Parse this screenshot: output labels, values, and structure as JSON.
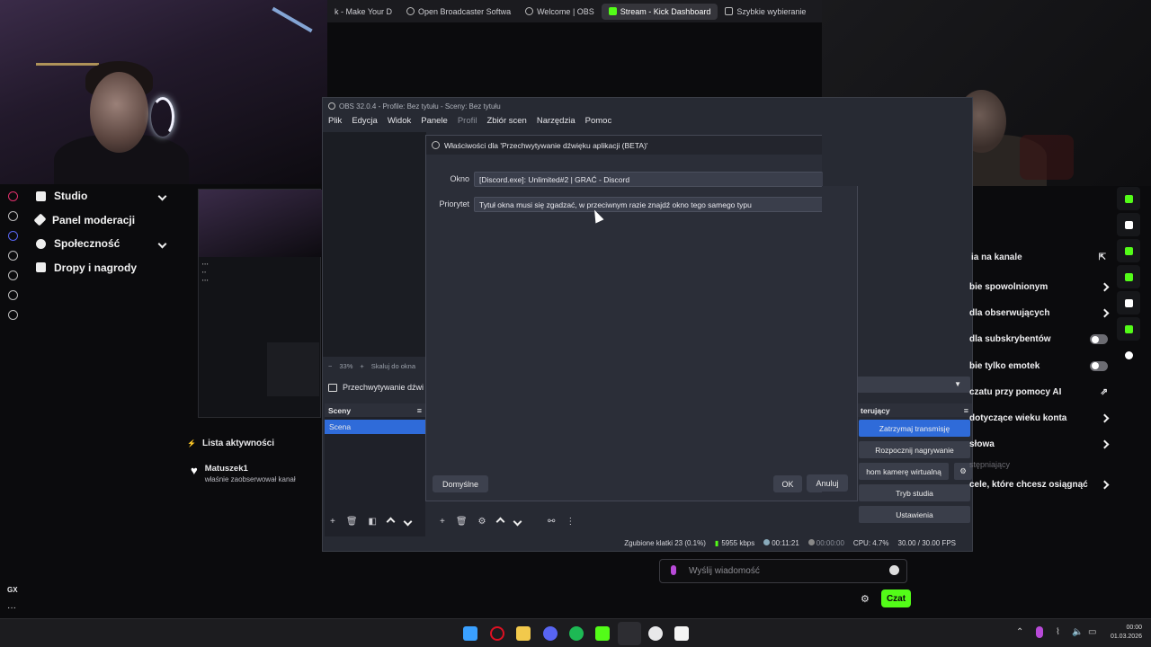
{
  "browser_tabs": [
    {
      "label": "k - Make Your D",
      "active": false
    },
    {
      "label": "Open Broadcaster Softwa",
      "active": false
    },
    {
      "label": "Welcome | OBS",
      "active": false
    },
    {
      "label": "Stream - Kick Dashboard",
      "active": true
    },
    {
      "label": "Szybkie wybieranie",
      "active": false
    }
  ],
  "obs": {
    "title": "OBS 32.0.4 - Profile: Bez tytułu - Sceny: Bez tytułu",
    "menu": [
      "Plik",
      "Edycja",
      "Widok",
      "Panele",
      "Profil",
      "Zbiór scen",
      "Narzędzia",
      "Pomoc"
    ],
    "zoom": "33%",
    "zoom_label": "Skaluj do okna",
    "source_name": "Przechwytywanie dźwi",
    "scenes_header": "Sceny",
    "scene_item": "Scena",
    "controls_header": "terujący",
    "controls": [
      "Zatrzymaj transmisję",
      "Rozpocznij nagrywanie",
      "hom kamerę wirtualną",
      "Tryb studia",
      "Ustawienia"
    ],
    "status": {
      "dropped": "Zgubione klatki 23 (0.1%)",
      "bitrate": "5955 kbps",
      "stream_time": "00:11:21",
      "rec_time": "00:00:00",
      "cpu": "CPU: 4.7%",
      "fps": "30.00 / 30.00 FPS"
    }
  },
  "dialog": {
    "title": "Właściwości dla 'Przechwytywanie dźwięku aplikacji (BETA)'",
    "window_label": "Okno",
    "window_value": "[Discord.exe]: Unlimited#2 | GRAĆ - Discord",
    "priority_label": "Priorytet",
    "priority_value": "Tytuł okna musi się zgadzać, w przeciwnym razie znajdź okno tego samego typu",
    "defaults_button": "Domyślne",
    "ok_button": "OK",
    "cancel_button": "Anuluj"
  },
  "nav": [
    "Studio",
    "Panel moderacji",
    "Społeczność",
    "Dropy i nagrody"
  ],
  "activity": {
    "header": "Lista aktywności",
    "user": "Matuszek1",
    "event": "właśnie zaobserwował kanał"
  },
  "chat_settings": {
    "title": "ia na kanale",
    "items": [
      {
        "label": "bie spowolnionym",
        "control": "chevron"
      },
      {
        "label": "dla obserwujących",
        "control": "chevron"
      },
      {
        "label": "dla subskrybentów",
        "control": "toggle"
      },
      {
        "label": "bie tylko emotek",
        "control": "toggle"
      },
      {
        "label": "czatu przy pomocy AI",
        "control": "link"
      },
      {
        "label": "dotyczące wieku konta",
        "control": "chevron"
      },
      {
        "label": "słowa",
        "control": "chevron"
      },
      {
        "label": "cele, które chcesz osiągnąć",
        "control": "chevron"
      }
    ],
    "dim_label": "stępniający"
  },
  "chat": {
    "placeholder": "Wyślij wiadomość",
    "send_label": "Czat"
  },
  "gx_label": "GX",
  "clock": {
    "time": "00:00",
    "date": "01.03.2026"
  },
  "colors": {
    "kick_green": "#53fc18",
    "obs_blue": "#2f6bd9"
  }
}
